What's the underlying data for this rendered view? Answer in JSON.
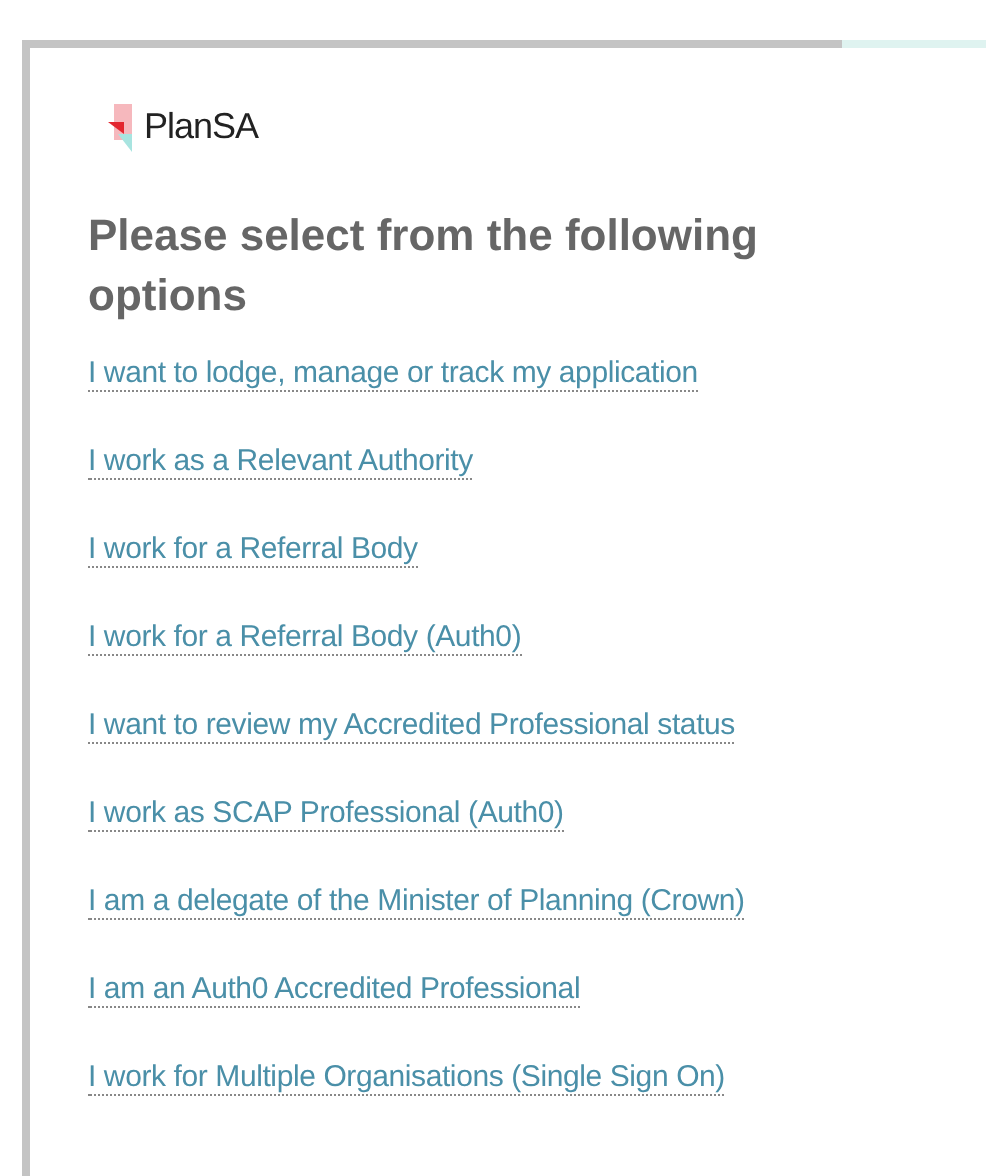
{
  "logo": {
    "text": "PlanSA"
  },
  "heading": "Please select from the following options",
  "options": [
    {
      "label": "I want to lodge, manage or track my application"
    },
    {
      "label": "I work as a Relevant Authority"
    },
    {
      "label": "I work for a Referral Body"
    },
    {
      "label": "I work for a Referral Body (Auth0)"
    },
    {
      "label": "I want to review my Accredited Professional status"
    },
    {
      "label": "I work as SCAP Professional (Auth0)"
    },
    {
      "label": "I am a delegate of the Minister of Planning (Crown)"
    },
    {
      "label": "I am an Auth0 Accredited Professional"
    },
    {
      "label": "I work for Multiple Organisations (Single Sign On)"
    }
  ]
}
